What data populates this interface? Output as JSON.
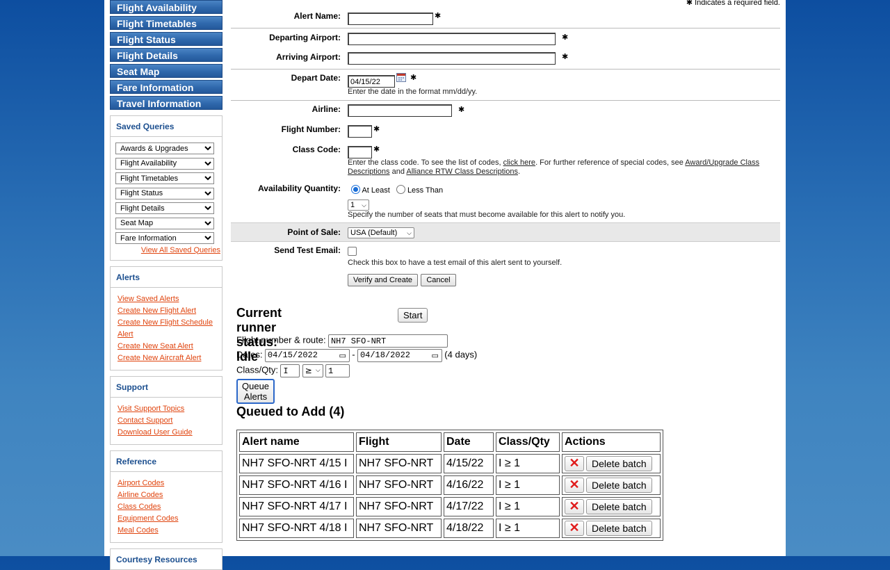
{
  "nav": [
    "Flight Availability",
    "Flight Timetables",
    "Flight Status",
    "Flight Details",
    "Seat Map",
    "Fare Information",
    "Travel Information"
  ],
  "saved_queries": {
    "title": "Saved Queries",
    "selects": [
      "Awards & Upgrades",
      "Flight Availability",
      "Flight Timetables",
      "Flight Status",
      "Flight Details",
      "Seat Map",
      "Fare Information"
    ],
    "view_all": "View All Saved Queries"
  },
  "alerts": {
    "title": "Alerts",
    "links": [
      "View Saved Alerts",
      "Create New Flight Alert",
      "Create New Flight Schedule Alert",
      "Create New Seat Alert",
      "Create New Aircraft Alert"
    ]
  },
  "support": {
    "title": "Support",
    "links": [
      "Visit Support Topics",
      "Contact Support",
      "Download User Guide"
    ]
  },
  "reference": {
    "title": "Reference",
    "links": [
      "Airport Codes",
      "Airline Codes",
      "Class Codes",
      "Equipment Codes",
      "Meal Codes"
    ]
  },
  "courtesy": {
    "title": "Courtesy Resources"
  },
  "form": {
    "required_note": "✱ Indicates a required field.",
    "star": "✱",
    "alert_name_label": "Alert Name:",
    "departing_label": "Departing Airport:",
    "arriving_label": "Arriving Airport:",
    "depart_date_label": "Depart Date:",
    "depart_date_value": "04/15/22",
    "depart_date_help": "Enter the date in the format mm/dd/yy.",
    "airline_label": "Airline:",
    "flight_number_label": "Flight Number:",
    "class_code_label": "Class Code:",
    "class_help_1": "Enter the class code. To see the list of codes, ",
    "class_help_link1": "click here",
    "class_help_2": ". For further reference of special codes, see ",
    "class_help_link2": "Award/Upgrade Class Descriptions",
    "class_help_3": " and ",
    "class_help_link3": "Alliance RTW Class Descriptions",
    "class_help_4": ".",
    "availability_label": "Availability Quantity:",
    "at_least": "At Least",
    "less_than": "Less Than",
    "qty_value": "1",
    "qty_help": "Specify the number of seats that must become available for this alert to notify you.",
    "pos_label": "Point of Sale:",
    "pos_value": "USA (Default)",
    "test_email_label": "Send Test Email:",
    "test_email_help": "Check this box to have a test email of this alert sent to yourself.",
    "verify_button": "Verify and Create",
    "cancel_button": "Cancel"
  },
  "runner": {
    "status_text": "Current runner status: Idle",
    "start_button": "Start",
    "route_label": "Flight number & route:",
    "route_value": "NH7 SFO-NRT",
    "dates_label": "Dates:",
    "date_from": "04/15/2022",
    "date_to": "04/18/2022",
    "dash": "-",
    "days": "(4 days)",
    "classqty_label": "Class/Qty:",
    "class_value": "I",
    "op_value": "≥",
    "qty_value": "1",
    "queue_button": "Queue Alerts"
  },
  "queue": {
    "title": "Queued to Add (4)",
    "headers": [
      "Alert name",
      "Flight",
      "Date",
      "Class/Qty",
      "Actions"
    ],
    "delete_label": "Delete batch",
    "x_glyph": "✕",
    "rows": [
      {
        "name": "NH7 SFO-NRT 4/15 I",
        "flight": "NH7 SFO-NRT",
        "date": "4/15/22",
        "cq": "I ≥ 1"
      },
      {
        "name": "NH7 SFO-NRT 4/16 I",
        "flight": "NH7 SFO-NRT",
        "date": "4/16/22",
        "cq": "I ≥ 1"
      },
      {
        "name": "NH7 SFO-NRT 4/17 I",
        "flight": "NH7 SFO-NRT",
        "date": "4/17/22",
        "cq": "I ≥ 1"
      },
      {
        "name": "NH7 SFO-NRT 4/18 I",
        "flight": "NH7 SFO-NRT",
        "date": "4/18/22",
        "cq": "I ≥ 1"
      }
    ]
  }
}
